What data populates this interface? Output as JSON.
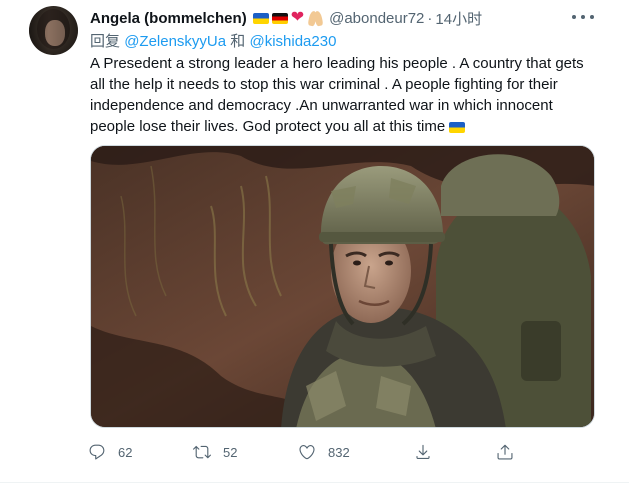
{
  "author": {
    "display_name": "Angela (bommelchen)",
    "handle": "@abondeur72",
    "separator": "·",
    "timestamp": "14小时",
    "name_emojis": [
      "flag-ukraine",
      "flag-germany",
      "red-heart",
      "folded-hands"
    ]
  },
  "reply": {
    "prefix": "回复",
    "mention_1": "@ZelenskyyUa",
    "conjunction": "和",
    "mention_2": "@kishida230"
  },
  "body": {
    "text": "A Presedent a strong leader a hero leading his people . A country that gets all the help it needs to stop this war criminal . A people fighting for their independence and democracy .An unwarranted war in which innocent people lose their lives. God protect you all at this time",
    "trailing_emoji": "flag-ukraine"
  },
  "actions": {
    "reply_count": "62",
    "retweet_count": "52",
    "like_count": "832"
  },
  "icons": {
    "reply": "reply-icon",
    "retweet": "retweet-icon",
    "like": "heart-icon",
    "download": "download-icon",
    "share": "share-icon",
    "more": "more-icon"
  },
  "colors": {
    "text": "#0f1419",
    "secondary": "#536471",
    "link": "#1d9bf0",
    "border": "#cfd9de"
  }
}
